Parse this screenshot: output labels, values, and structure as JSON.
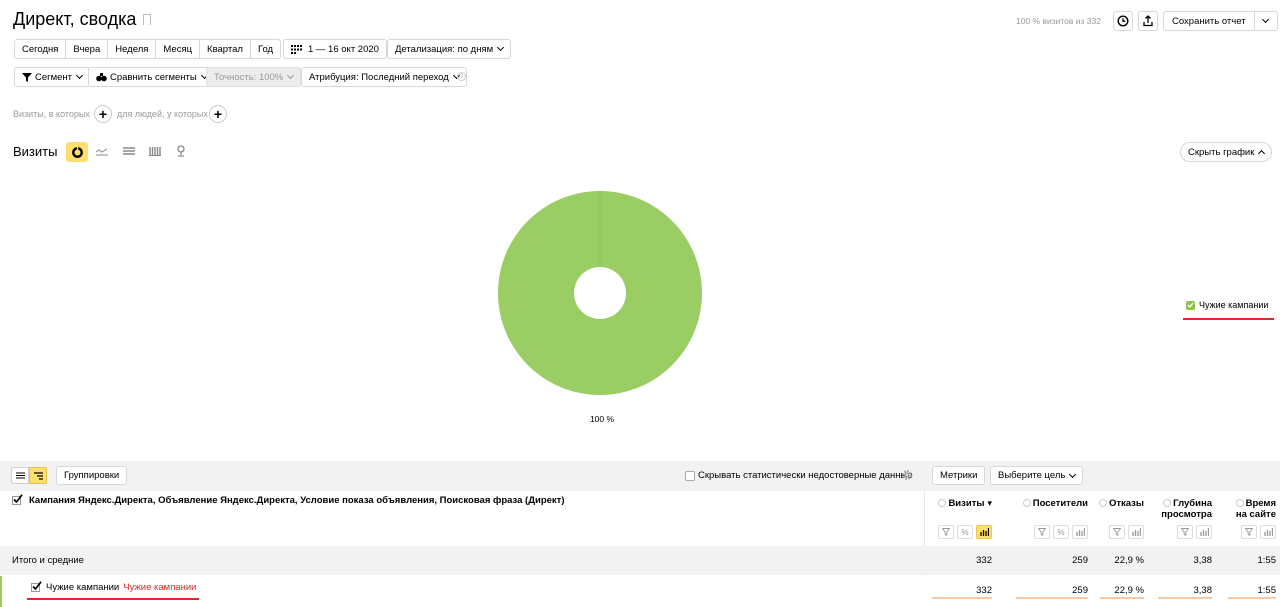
{
  "header": {
    "title": "Директ, сводка",
    "visits_share": "100 % визитов из 332",
    "save_report": "Сохранить отчет"
  },
  "period": {
    "buttons": [
      "Сегодня",
      "Вчера",
      "Неделя",
      "Месяц",
      "Квартал",
      "Год"
    ],
    "date_range": "1 — 16 окт 2020",
    "detail": "Детализация: по дням"
  },
  "filters": {
    "segment": "Сегмент",
    "compare": "Сравнить сегменты",
    "accuracy": "Точность: 100%",
    "attribution": "Атрибуция: Последний переход"
  },
  "conditions": {
    "visits_where": "Визиты, в которых",
    "people_where": "для людей, у которых"
  },
  "chart_section": {
    "title": "Визиты",
    "hide_chart": "Скрыть график",
    "icons": [
      "pie-chart-icon",
      "line-chart-icon",
      "area-chart-icon",
      "bar-chart-icon",
      "map-pin-icon"
    ]
  },
  "chart_data": {
    "type": "pie",
    "categories": [
      "Чужие кампании"
    ],
    "values": [
      100
    ],
    "labels": [
      "100 %"
    ],
    "legend": "right",
    "colors": [
      "#9acd63"
    ]
  },
  "table_toolbar": {
    "groupings": "Группировки",
    "hide_unreliable": "Скрывать статистически недостоверные данные",
    "metrics": "Метрики",
    "choose_goal": "Выберите цель"
  },
  "table": {
    "dimension_header": "Кампания Яндекс.Директа, Объявление Яндекс.Директа, Условие показа объявления, Поисковая фраза (Директ)",
    "columns": [
      {
        "line1": "Визиты",
        "line2": "",
        "sorted": "▾"
      },
      {
        "line1": "Посетители",
        "line2": "",
        "sorted": ""
      },
      {
        "line1": "Отказы",
        "line2": "",
        "sorted": ""
      },
      {
        "line1": "Глубина",
        "line2": "просмотра",
        "sorted": ""
      },
      {
        "line1": "Время",
        "line2": "на сайте",
        "sorted": ""
      }
    ],
    "totals": {
      "label": "Итого и средние",
      "values": [
        "332",
        "259",
        "22,9 %",
        "3,38",
        "1:55"
      ]
    },
    "rows": [
      {
        "label_plain": "Чужие кампании",
        "label_link": "Чужие кампании",
        "values": [
          "332",
          "259",
          "22,9 %",
          "3,38",
          "1:55"
        ]
      }
    ]
  },
  "colors": {
    "pie": "#9acd63",
    "accent_yellow": "#ffdf6b",
    "link_red": "#e8252d",
    "checkbox_green": "#8bc34a"
  }
}
